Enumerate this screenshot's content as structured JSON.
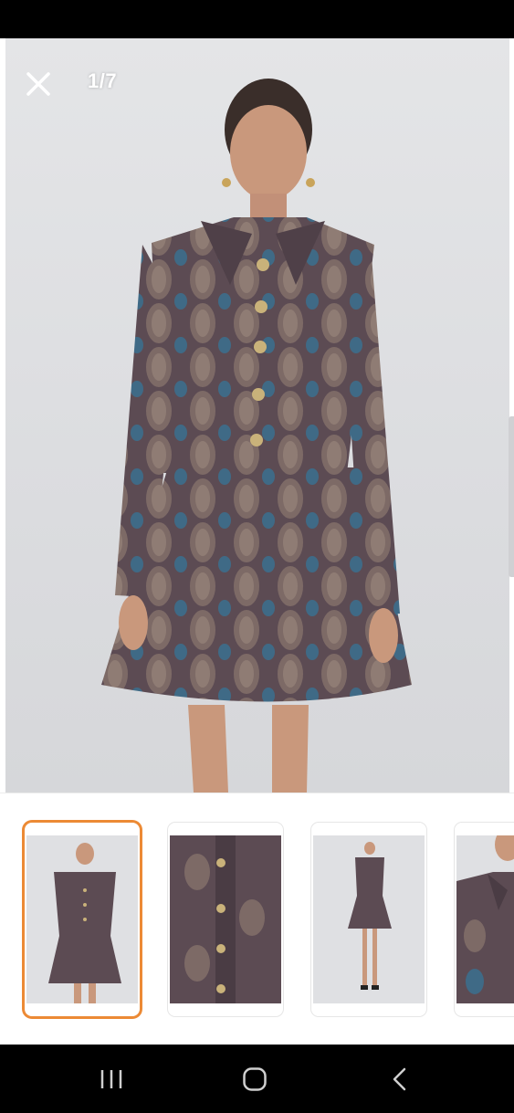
{
  "viewer": {
    "counter": "1/7",
    "close_icon": "close-icon"
  },
  "thumbnails": {
    "selected_index": 0,
    "accent_color": "#ec8a35",
    "items": [
      {
        "description_icon": "outfit-front-thumbnail"
      },
      {
        "description_icon": "jacket-detail-thumbnail"
      },
      {
        "description_icon": "full-body-thumbnail"
      },
      {
        "description_icon": "collar-closeup-thumbnail"
      }
    ]
  },
  "navigation": {
    "recents_icon": "recents-icon",
    "home_icon": "home-icon",
    "back_icon": "back-icon"
  },
  "colors": {
    "fabric_base": "#5a4a52",
    "fabric_blue": "#3f6a86",
    "skin": "#c9987c",
    "button_gold": "#c9b27a"
  }
}
